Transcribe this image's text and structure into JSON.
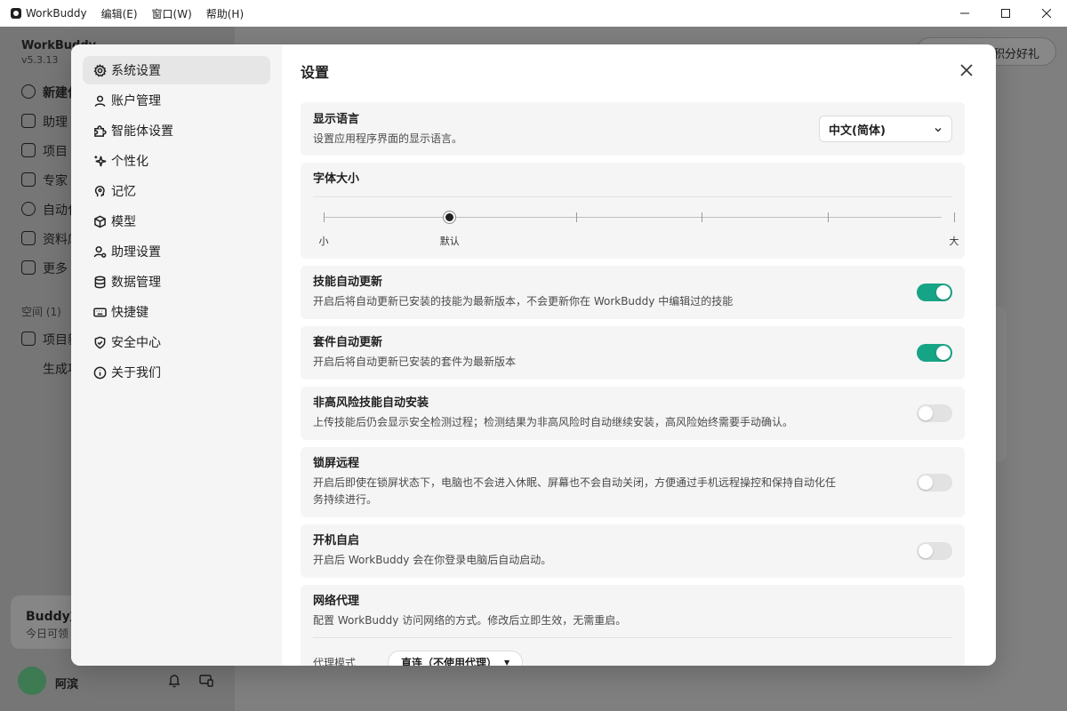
{
  "titlebar": {
    "app_name": "WorkBuddy",
    "menus": [
      "编辑(E)",
      "窗口(W)",
      "帮助(H)"
    ]
  },
  "background": {
    "brand": "WorkBuddy",
    "version": "v5.3.13",
    "nav": [
      "新建任",
      "助理",
      "项目",
      "专家",
      "自动化",
      "资料库",
      "更多"
    ],
    "space_label": "空间 (1)",
    "project_item": "项目新",
    "sub_item": "生成项",
    "promo_title": "Buddy加",
    "promo_desc": "今日可领",
    "user_name": "阿滨",
    "pill_text": "积分好礼"
  },
  "settings": {
    "title": "设置",
    "nav": [
      {
        "label": "系统设置",
        "icon": "gear-icon",
        "active": true
      },
      {
        "label": "账户管理",
        "icon": "user-icon"
      },
      {
        "label": "智能体设置",
        "icon": "puzzle-icon"
      },
      {
        "label": "个性化",
        "icon": "sparkle-icon"
      },
      {
        "label": "记忆",
        "icon": "brain-icon"
      },
      {
        "label": "模型",
        "icon": "cube-icon"
      },
      {
        "label": "助理设置",
        "icon": "user-gear-icon"
      },
      {
        "label": "数据管理",
        "icon": "database-icon"
      },
      {
        "label": "快捷键",
        "icon": "keyboard-icon"
      },
      {
        "label": "安全中心",
        "icon": "shield-icon"
      },
      {
        "label": "关于我们",
        "icon": "info-icon"
      }
    ],
    "language": {
      "title": "显示语言",
      "desc": "设置应用程序界面的显示语言。",
      "value": "中文(简体)"
    },
    "font_size": {
      "title": "字体大小",
      "min_label": "小",
      "default_label": "默认",
      "max_label": "大",
      "steps": 6,
      "selected_index": 1
    },
    "toggles": {
      "skill_update": {
        "title": "技能自动更新",
        "desc": "开启后将自动更新已安装的技能为最新版本，不会更新你在 WorkBuddy 中编辑过的技能",
        "on": true
      },
      "kit_update": {
        "title": "套件自动更新",
        "desc": "开启后将自动更新已安装的套件为最新版本",
        "on": true
      },
      "auto_install": {
        "title": "非高风险技能自动安装",
        "desc": "上传技能后仍会显示安全检测过程；检测结果为非高风险时自动继续安装，高风险始终需要手动确认。",
        "on": false
      },
      "lock_remote": {
        "title": "锁屏远程",
        "desc_line1": "开启后即使在锁屏状态下，电脑也不会进入休眠、屏幕也不会自动关闭，方便通过手机远程操控和保持自动化任",
        "desc_line2": "务持续进行。",
        "on": false
      },
      "auto_start": {
        "title": "开机自启",
        "desc": "开启后 WorkBuddy 会在你登录电脑后自动启动。",
        "on": false
      }
    },
    "proxy": {
      "title": "网络代理",
      "desc": "配置 WorkBuddy 访问网络的方式。修改后立即生效，无需重启。",
      "mode_label": "代理模式",
      "mode_value": "直连（不使用代理）"
    }
  },
  "colors": {
    "toggle_on": "#16a486",
    "toggle_off": "#e2e2e2",
    "overlay": "#7a7a7a"
  }
}
